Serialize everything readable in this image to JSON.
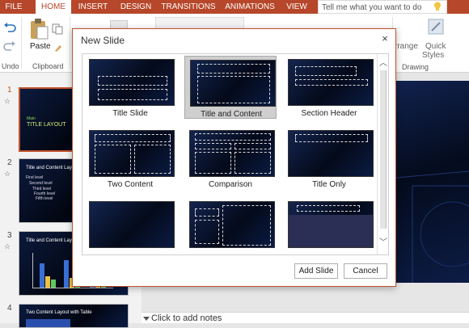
{
  "ribbon": {
    "tabs": [
      "FILE",
      "HOME",
      "INSERT",
      "DESIGN",
      "TRANSITIONS",
      "ANIMATIONS",
      "VIEW"
    ],
    "active_tab": "HOME",
    "tell_me": "Tell me what you want to do",
    "paste_label": "Paste",
    "undo_label": "Undo",
    "clipboard_label": "Clipboard",
    "arrange_label": "rrange",
    "quick_styles_label_1": "Quick",
    "quick_styles_label_2": "Styles",
    "drawing_label": "Drawing"
  },
  "thumbnails": {
    "slides": [
      {
        "number": "1",
        "title": "TITLE LAYOUT",
        "pre": "Main"
      },
      {
        "number": "2",
        "title": "Title and Content Layout with List",
        "lines": [
          "First level",
          "Second level",
          "Third level",
          "Fourth level",
          "Fifth level"
        ]
      },
      {
        "number": "3",
        "title": "Title and Content Layout with Chart"
      },
      {
        "number": "4",
        "title": "Two Content Layout with Table"
      }
    ]
  },
  "notes": {
    "placeholder": "Click to add notes"
  },
  "dialog": {
    "title": "New Slide",
    "close": "×",
    "layouts": [
      {
        "name": "Title Slide"
      },
      {
        "name": "Title and Content",
        "selected": true
      },
      {
        "name": "Section Header"
      },
      {
        "name": "Two Content"
      },
      {
        "name": "Comparison"
      },
      {
        "name": "Title Only"
      }
    ],
    "add_button": "Add Slide",
    "cancel_button": "Cancel"
  },
  "colors": {
    "accent": "#b7472a",
    "selection": "#c0522e"
  }
}
